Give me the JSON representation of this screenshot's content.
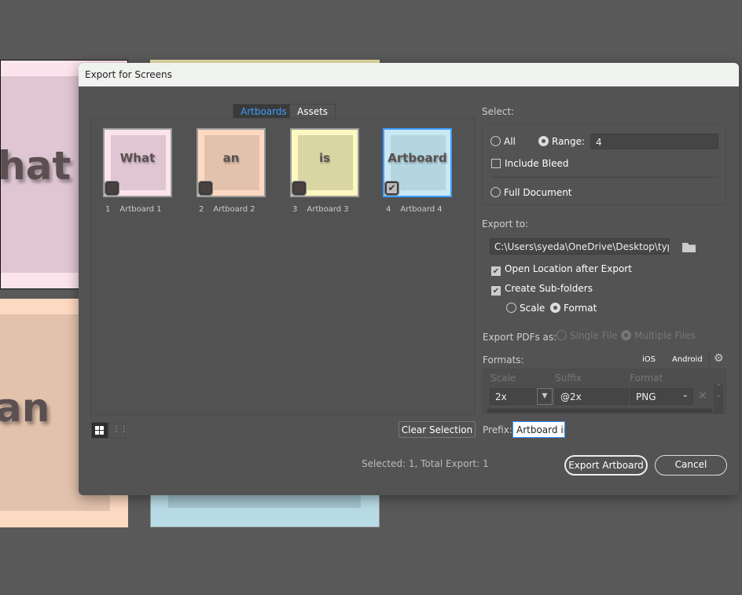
{
  "dialog": {
    "title": "Export for Screens"
  },
  "canvas": {
    "artboard_words": [
      "hat",
      "an"
    ]
  },
  "tabs": [
    {
      "label": "Artboards",
      "active": true
    },
    {
      "label": "Assets",
      "active": false
    }
  ],
  "artboards": [
    {
      "num": "1",
      "name": "Artboard 1",
      "word": "What",
      "checked": false,
      "color": "#fce4ec",
      "inner": "#dfc6d2"
    },
    {
      "num": "2",
      "name": "Artboard 2",
      "word": "an",
      "checked": false,
      "color": "#fed9c1",
      "inner": "#e2c2ac"
    },
    {
      "num": "3",
      "name": "Artboard 3",
      "word": "is",
      "checked": false,
      "color": "#fdf8c2",
      "inner": "#dad6a4"
    },
    {
      "num": "4",
      "name": "Artboard 4",
      "word": "Artboard",
      "checked": true,
      "color": "#c9e8f2",
      "inner": "#b4d6e0"
    }
  ],
  "view": {
    "grid_icon": "grid-view-icon",
    "list_icon": "list-view-icon"
  },
  "clear_selection": "Clear Selection",
  "status": "Selected: 1, Total Export: 1",
  "select": {
    "label": "Select:",
    "all": "All",
    "range": "Range:",
    "range_value": "4",
    "include_bleed": "Include Bleed",
    "full_document": "Full Document",
    "selected_option": "Range"
  },
  "export_to": {
    "label": "Export to:",
    "path": "C:\\Users\\syeda\\OneDrive\\Desktop\\typer",
    "open_location": "Open Location after Export",
    "open_location_checked": true,
    "create_subfolders": "Create Sub-folders",
    "create_subfolders_checked": true,
    "scale": "Scale",
    "format": "Format",
    "subfolder_by": "Format"
  },
  "pdf": {
    "label": "Export PDFs as:",
    "single": "Single File",
    "multiple": "Multiple Files"
  },
  "formats": {
    "label": "Formats:",
    "ios": "iOS",
    "android": "Android",
    "headers": {
      "scale": "Scale",
      "suffix": "Suffix",
      "format": "Format"
    },
    "rows": [
      {
        "scale": "2x",
        "suffix": "@2x",
        "format": "PNG"
      }
    ]
  },
  "prefix": {
    "label": "Prefix:",
    "value": "Artboard ir"
  },
  "buttons": {
    "export": "Export Artboard",
    "cancel": "Cancel"
  },
  "colors": {
    "accent": "#3b9dff",
    "dialog_bg": "#535353",
    "title_bg": "#f0f2ef"
  }
}
